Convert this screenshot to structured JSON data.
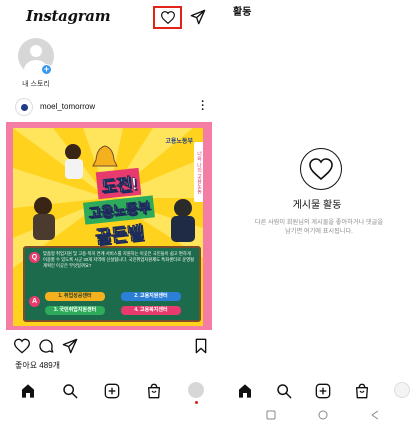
{
  "left": {
    "logo": "Instagram",
    "story": {
      "label": "내 스토리"
    },
    "post": {
      "username": "moel_tomorrow",
      "image": {
        "agency_logo": "고용노동부",
        "side_tab": "너와 나의 고용노동",
        "title_line1": "도전!",
        "title_line2": "고용노동부",
        "title_line3": "골든벨",
        "q_badge": "Q",
        "question": "맞춤형 취업지원 및 고용·복지 연계 서비스를 지원하는 이곳은 국민들이 쉽고 편하게 이용할 수 있도록 시군 30개 지역에 신설됩니다. 국민취업지원제도 특화센터로 운영될 계획인 이곳은 무엇일까요?",
        "a_badge": "A",
        "options": [
          "1. 취업성공센터",
          "2. 고용지원센터",
          "3. 국민취업지원센터",
          "4. 고용복지센터"
        ]
      },
      "likes": "좋아요 489개"
    }
  },
  "right": {
    "title": "활동",
    "empty_title": "게시물 활동",
    "empty_desc": "다른 사람이 회원님의 게시물을 좋아하거나 댓글을 남기면 여기에 표시됩니다."
  },
  "colors": {
    "highlight": "#e2231a",
    "post_bg": "#f47ea3",
    "poster_yellow": "#ffd21e",
    "board_green": "#1d6b4d"
  }
}
